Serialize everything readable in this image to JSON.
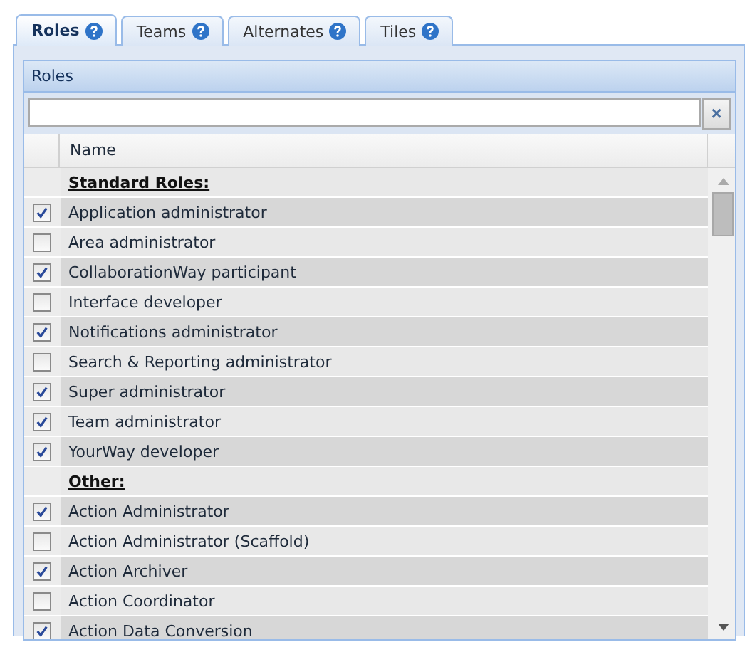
{
  "tabs": [
    {
      "label": "Roles",
      "selected": true
    },
    {
      "label": "Teams",
      "selected": false
    },
    {
      "label": "Alternates",
      "selected": false
    },
    {
      "label": "Tiles",
      "selected": false
    }
  ],
  "panel": {
    "title": "Roles"
  },
  "search": {
    "clear": "×"
  },
  "table": {
    "columns": [
      "Name"
    ],
    "rows": [
      {
        "kind": "group",
        "name": "Standard Roles:"
      },
      {
        "kind": "role",
        "name": "Application administrator",
        "checked": true
      },
      {
        "kind": "role",
        "name": "Area administrator",
        "checked": false
      },
      {
        "kind": "role",
        "name": "CollaborationWay participant",
        "checked": true
      },
      {
        "kind": "role",
        "name": "Interface developer",
        "checked": false
      },
      {
        "kind": "role",
        "name": "Notifications administrator",
        "checked": true
      },
      {
        "kind": "role",
        "name": "Search & Reporting administrator",
        "checked": false
      },
      {
        "kind": "role",
        "name": "Super administrator",
        "checked": true
      },
      {
        "kind": "role",
        "name": "Team administrator",
        "checked": true
      },
      {
        "kind": "role",
        "name": "YourWay developer",
        "checked": true
      },
      {
        "kind": "group",
        "name": "Other:"
      },
      {
        "kind": "role",
        "name": "Action Administrator",
        "checked": true
      },
      {
        "kind": "role",
        "name": "Action Administrator (Scaffold)",
        "checked": false
      },
      {
        "kind": "role",
        "name": "Action Archiver",
        "checked": true
      },
      {
        "kind": "role",
        "name": "Action Coordinator",
        "checked": false
      },
      {
        "kind": "role",
        "name": "Action Data Conversion",
        "checked": true
      }
    ]
  }
}
